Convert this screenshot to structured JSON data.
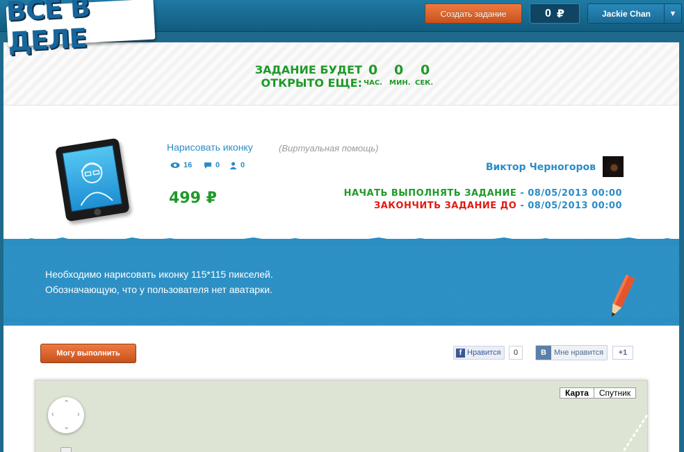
{
  "header": {
    "logo_text": "ВСЕ В ДЕЛЕ",
    "create_task_label": "Создать задание",
    "balance_value": "0",
    "currency_symbol": "₽",
    "user_name": "Jackie Chan",
    "dropdown_arrow": "▼"
  },
  "timer": {
    "label_line1": "ЗАДАНИЕ БУДЕТ",
    "label_line2": "ОТКРЫТО ЕЩЕ:",
    "hours": "0",
    "minutes": "0",
    "seconds": "0",
    "hours_unit": "ЧАС.",
    "minutes_unit": "МИН.",
    "seconds_unit": "СЕК."
  },
  "task": {
    "title": "Нарисовать иконку",
    "category": "(Виртуальная помощь)",
    "views": "16",
    "comments": "0",
    "users": "0",
    "price": "499",
    "currency_symbol": "₽",
    "author": "Виктор Черногоров",
    "start_label": "НАЧАТЬ ВЫПОЛНЯТЬ ЗАДАНИЕ",
    "start_date": "- 08/05/2013 00:00",
    "end_label": "ЗАКОНЧИТЬ ЗАДАНИЕ ДО",
    "end_date": "- 08/05/2013 00:00",
    "description_line1": "Необходимо нарисовать иконку 115*115 пикселей.",
    "description_line2": "Обозначающую, что у пользователя нет аватарки."
  },
  "actions": {
    "can_do_label": "Могу выполнить",
    "fb_like_label": "Нравится",
    "fb_like_count": "0",
    "vk_icon": "В",
    "vk_like_label": "Мне нравится",
    "gplus_label": "+1"
  },
  "map": {
    "map_label": "Карта",
    "satellite_label": "Спутник"
  },
  "colors": {
    "accent_green": "#1f9a2a",
    "accent_red": "#e01b12",
    "link_blue": "#2b8cc6",
    "orange_button": "#d9602a"
  }
}
